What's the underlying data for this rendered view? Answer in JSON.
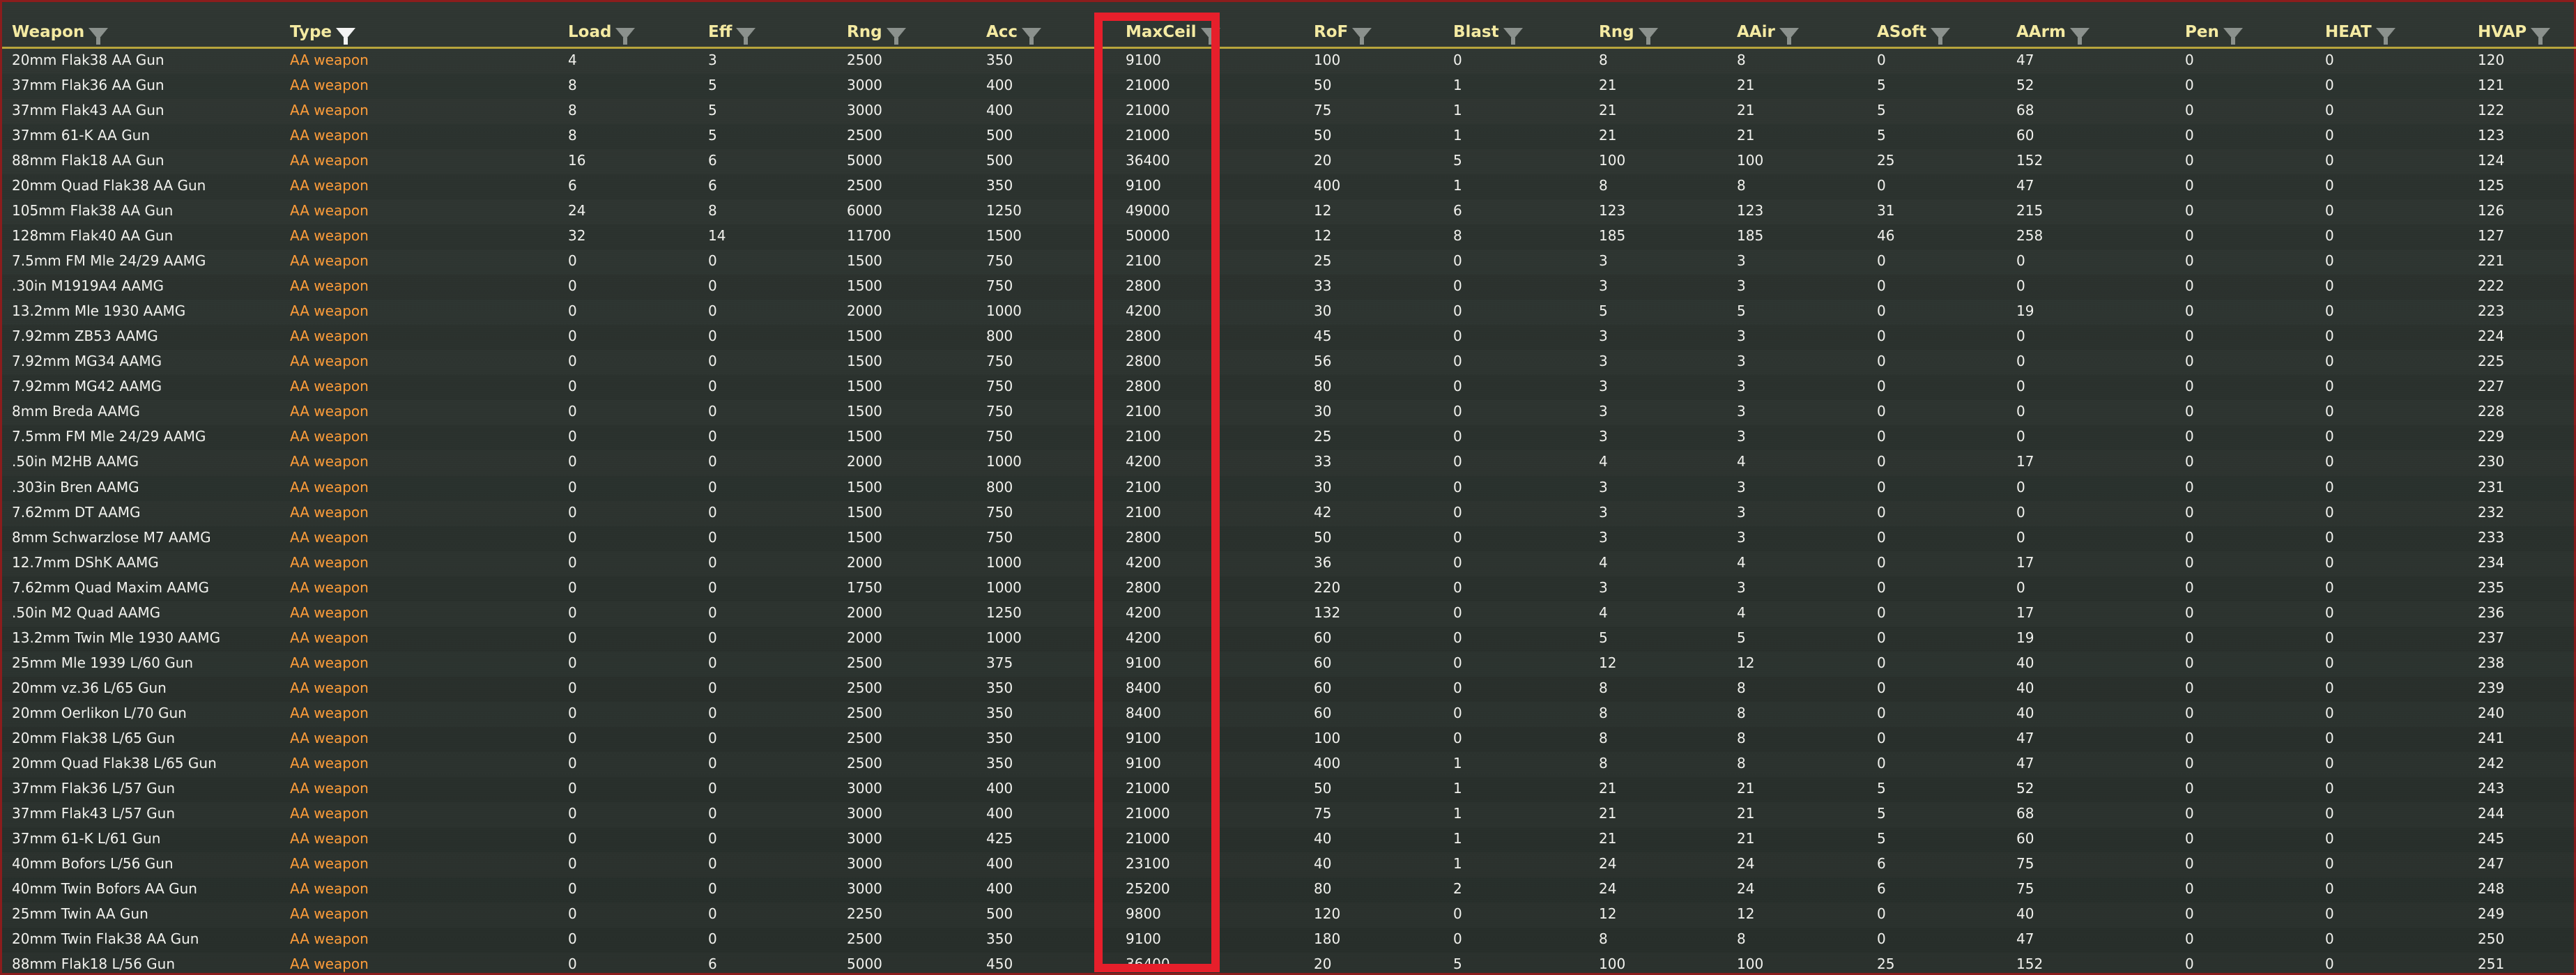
{
  "columns": [
    {
      "key": "weapon",
      "label": "Weapon",
      "filter_active": false
    },
    {
      "key": "type",
      "label": "Type",
      "filter_active": true
    },
    {
      "key": "load",
      "label": "Load",
      "filter_active": false
    },
    {
      "key": "eff",
      "label": "Eff",
      "filter_active": false
    },
    {
      "key": "rng",
      "label": "Rng",
      "filter_active": false
    },
    {
      "key": "acc",
      "label": "Acc",
      "filter_active": false
    },
    {
      "key": "maxceil",
      "label": "MaxCeil",
      "filter_active": false
    },
    {
      "key": "rof",
      "label": "RoF",
      "filter_active": false
    },
    {
      "key": "blast",
      "label": "Blast",
      "filter_active": false
    },
    {
      "key": "rng2",
      "label": "Rng",
      "filter_active": false
    },
    {
      "key": "aair",
      "label": "AAir",
      "filter_active": false
    },
    {
      "key": "asoft",
      "label": "ASoft",
      "filter_active": false
    },
    {
      "key": "aarm",
      "label": "AArm",
      "filter_active": false
    },
    {
      "key": "pen",
      "label": "Pen",
      "filter_active": false
    },
    {
      "key": "heat",
      "label": "HEAT",
      "filter_active": false
    },
    {
      "key": "hvap",
      "label": "HVAP",
      "filter_active": false
    }
  ],
  "rows": [
    [
      "20mm Flak38 AA Gun",
      "AA weapon",
      "4",
      "3",
      "2500",
      "350",
      "9100",
      "100",
      "0",
      "8",
      "8",
      "0",
      "47",
      "0",
      "0",
      "120"
    ],
    [
      "37mm Flak36 AA Gun",
      "AA weapon",
      "8",
      "5",
      "3000",
      "400",
      "21000",
      "50",
      "1",
      "21",
      "21",
      "5",
      "52",
      "0",
      "0",
      "121"
    ],
    [
      "37mm Flak43 AA Gun",
      "AA weapon",
      "8",
      "5",
      "3000",
      "400",
      "21000",
      "75",
      "1",
      "21",
      "21",
      "5",
      "68",
      "0",
      "0",
      "122"
    ],
    [
      "37mm 61-K AA Gun",
      "AA weapon",
      "8",
      "5",
      "2500",
      "500",
      "21000",
      "50",
      "1",
      "21",
      "21",
      "5",
      "60",
      "0",
      "0",
      "123"
    ],
    [
      "88mm Flak18 AA Gun",
      "AA weapon",
      "16",
      "6",
      "5000",
      "500",
      "36400",
      "20",
      "5",
      "100",
      "100",
      "25",
      "152",
      "0",
      "0",
      "124"
    ],
    [
      "20mm Quad Flak38 AA Gun",
      "AA weapon",
      "6",
      "6",
      "2500",
      "350",
      "9100",
      "400",
      "1",
      "8",
      "8",
      "0",
      "47",
      "0",
      "0",
      "125"
    ],
    [
      "105mm Flak38 AA Gun",
      "AA weapon",
      "24",
      "8",
      "6000",
      "1250",
      "49000",
      "12",
      "6",
      "123",
      "123",
      "31",
      "215",
      "0",
      "0",
      "126"
    ],
    [
      "128mm Flak40 AA Gun",
      "AA weapon",
      "32",
      "14",
      "11700",
      "1500",
      "50000",
      "12",
      "8",
      "185",
      "185",
      "46",
      "258",
      "0",
      "0",
      "127"
    ],
    [
      "7.5mm FM Mle 24/29 AAMG",
      "AA weapon",
      "0",
      "0",
      "1500",
      "750",
      "2100",
      "25",
      "0",
      "3",
      "3",
      "0",
      "0",
      "0",
      "0",
      "221"
    ],
    [
      ".30in M1919A4 AAMG",
      "AA weapon",
      "0",
      "0",
      "1500",
      "750",
      "2800",
      "33",
      "0",
      "3",
      "3",
      "0",
      "0",
      "0",
      "0",
      "222"
    ],
    [
      "13.2mm Mle 1930 AAMG",
      "AA weapon",
      "0",
      "0",
      "2000",
      "1000",
      "4200",
      "30",
      "0",
      "5",
      "5",
      "0",
      "19",
      "0",
      "0",
      "223"
    ],
    [
      "7.92mm ZB53 AAMG",
      "AA weapon",
      "0",
      "0",
      "1500",
      "800",
      "2800",
      "45",
      "0",
      "3",
      "3",
      "0",
      "0",
      "0",
      "0",
      "224"
    ],
    [
      "7.92mm MG34 AAMG",
      "AA weapon",
      "0",
      "0",
      "1500",
      "750",
      "2800",
      "56",
      "0",
      "3",
      "3",
      "0",
      "0",
      "0",
      "0",
      "225"
    ],
    [
      "7.92mm MG42 AAMG",
      "AA weapon",
      "0",
      "0",
      "1500",
      "750",
      "2800",
      "80",
      "0",
      "3",
      "3",
      "0",
      "0",
      "0",
      "0",
      "227"
    ],
    [
      "8mm Breda AAMG",
      "AA weapon",
      "0",
      "0",
      "1500",
      "750",
      "2100",
      "30",
      "0",
      "3",
      "3",
      "0",
      "0",
      "0",
      "0",
      "228"
    ],
    [
      "7.5mm FM Mle 24/29 AAMG",
      "AA weapon",
      "0",
      "0",
      "1500",
      "750",
      "2100",
      "25",
      "0",
      "3",
      "3",
      "0",
      "0",
      "0",
      "0",
      "229"
    ],
    [
      ".50in M2HB AAMG",
      "AA weapon",
      "0",
      "0",
      "2000",
      "1000",
      "4200",
      "33",
      "0",
      "4",
      "4",
      "0",
      "17",
      "0",
      "0",
      "230"
    ],
    [
      ".303in Bren AAMG",
      "AA weapon",
      "0",
      "0",
      "1500",
      "800",
      "2100",
      "30",
      "0",
      "3",
      "3",
      "0",
      "0",
      "0",
      "0",
      "231"
    ],
    [
      "7.62mm DT AAMG",
      "AA weapon",
      "0",
      "0",
      "1500",
      "750",
      "2100",
      "42",
      "0",
      "3",
      "3",
      "0",
      "0",
      "0",
      "0",
      "232"
    ],
    [
      "8mm Schwarzlose M7 AAMG",
      "AA weapon",
      "0",
      "0",
      "1500",
      "750",
      "2800",
      "50",
      "0",
      "3",
      "3",
      "0",
      "0",
      "0",
      "0",
      "233"
    ],
    [
      "12.7mm DShK AAMG",
      "AA weapon",
      "0",
      "0",
      "2000",
      "1000",
      "4200",
      "36",
      "0",
      "4",
      "4",
      "0",
      "17",
      "0",
      "0",
      "234"
    ],
    [
      "7.62mm Quad Maxim AAMG",
      "AA weapon",
      "0",
      "0",
      "1750",
      "1000",
      "2800",
      "220",
      "0",
      "3",
      "3",
      "0",
      "0",
      "0",
      "0",
      "235"
    ],
    [
      ".50in M2 Quad AAMG",
      "AA weapon",
      "0",
      "0",
      "2000",
      "1250",
      "4200",
      "132",
      "0",
      "4",
      "4",
      "0",
      "17",
      "0",
      "0",
      "236"
    ],
    [
      "13.2mm Twin Mle 1930 AAMG",
      "AA weapon",
      "0",
      "0",
      "2000",
      "1000",
      "4200",
      "60",
      "0",
      "5",
      "5",
      "0",
      "19",
      "0",
      "0",
      "237"
    ],
    [
      "25mm Mle 1939 L/60 Gun",
      "AA weapon",
      "0",
      "0",
      "2500",
      "375",
      "9100",
      "60",
      "0",
      "12",
      "12",
      "0",
      "40",
      "0",
      "0",
      "238"
    ],
    [
      "20mm vz.36 L/65 Gun",
      "AA weapon",
      "0",
      "0",
      "2500",
      "350",
      "8400",
      "60",
      "0",
      "8",
      "8",
      "0",
      "40",
      "0",
      "0",
      "239"
    ],
    [
      "20mm Oerlikon L/70 Gun",
      "AA weapon",
      "0",
      "0",
      "2500",
      "350",
      "8400",
      "60",
      "0",
      "8",
      "8",
      "0",
      "40",
      "0",
      "0",
      "240"
    ],
    [
      "20mm Flak38 L/65 Gun",
      "AA weapon",
      "0",
      "0",
      "2500",
      "350",
      "9100",
      "100",
      "0",
      "8",
      "8",
      "0",
      "47",
      "0",
      "0",
      "241"
    ],
    [
      "20mm Quad Flak38 L/65 Gun",
      "AA weapon",
      "0",
      "0",
      "2500",
      "350",
      "9100",
      "400",
      "1",
      "8",
      "8",
      "0",
      "47",
      "0",
      "0",
      "242"
    ],
    [
      "37mm Flak36 L/57 Gun",
      "AA weapon",
      "0",
      "0",
      "3000",
      "400",
      "21000",
      "50",
      "1",
      "21",
      "21",
      "5",
      "52",
      "0",
      "0",
      "243"
    ],
    [
      "37mm Flak43 L/57 Gun",
      "AA weapon",
      "0",
      "0",
      "3000",
      "400",
      "21000",
      "75",
      "1",
      "21",
      "21",
      "5",
      "68",
      "0",
      "0",
      "244"
    ],
    [
      "37mm 61-K L/61 Gun",
      "AA weapon",
      "0",
      "0",
      "3000",
      "425",
      "21000",
      "40",
      "1",
      "21",
      "21",
      "5",
      "60",
      "0",
      "0",
      "245"
    ],
    [
      "40mm Bofors L/56 Gun",
      "AA weapon",
      "0",
      "0",
      "3000",
      "400",
      "23100",
      "40",
      "1",
      "24",
      "24",
      "6",
      "75",
      "0",
      "0",
      "247"
    ],
    [
      "40mm Twin Bofors AA Gun",
      "AA weapon",
      "0",
      "0",
      "3000",
      "400",
      "25200",
      "80",
      "2",
      "24",
      "24",
      "6",
      "75",
      "0",
      "0",
      "248"
    ],
    [
      "25mm Twin AA Gun",
      "AA weapon",
      "0",
      "0",
      "2250",
      "500",
      "9800",
      "120",
      "0",
      "12",
      "12",
      "0",
      "40",
      "0",
      "0",
      "249"
    ],
    [
      "20mm Twin Flak38 AA Gun",
      "AA weapon",
      "0",
      "0",
      "2500",
      "350",
      "9100",
      "180",
      "0",
      "8",
      "8",
      "0",
      "47",
      "0",
      "0",
      "250"
    ],
    [
      "88mm Flak18 L/56 Gun",
      "AA weapon",
      "0",
      "6",
      "5000",
      "450",
      "36400",
      "20",
      "5",
      "100",
      "100",
      "25",
      "152",
      "0",
      "0",
      "251"
    ]
  ]
}
